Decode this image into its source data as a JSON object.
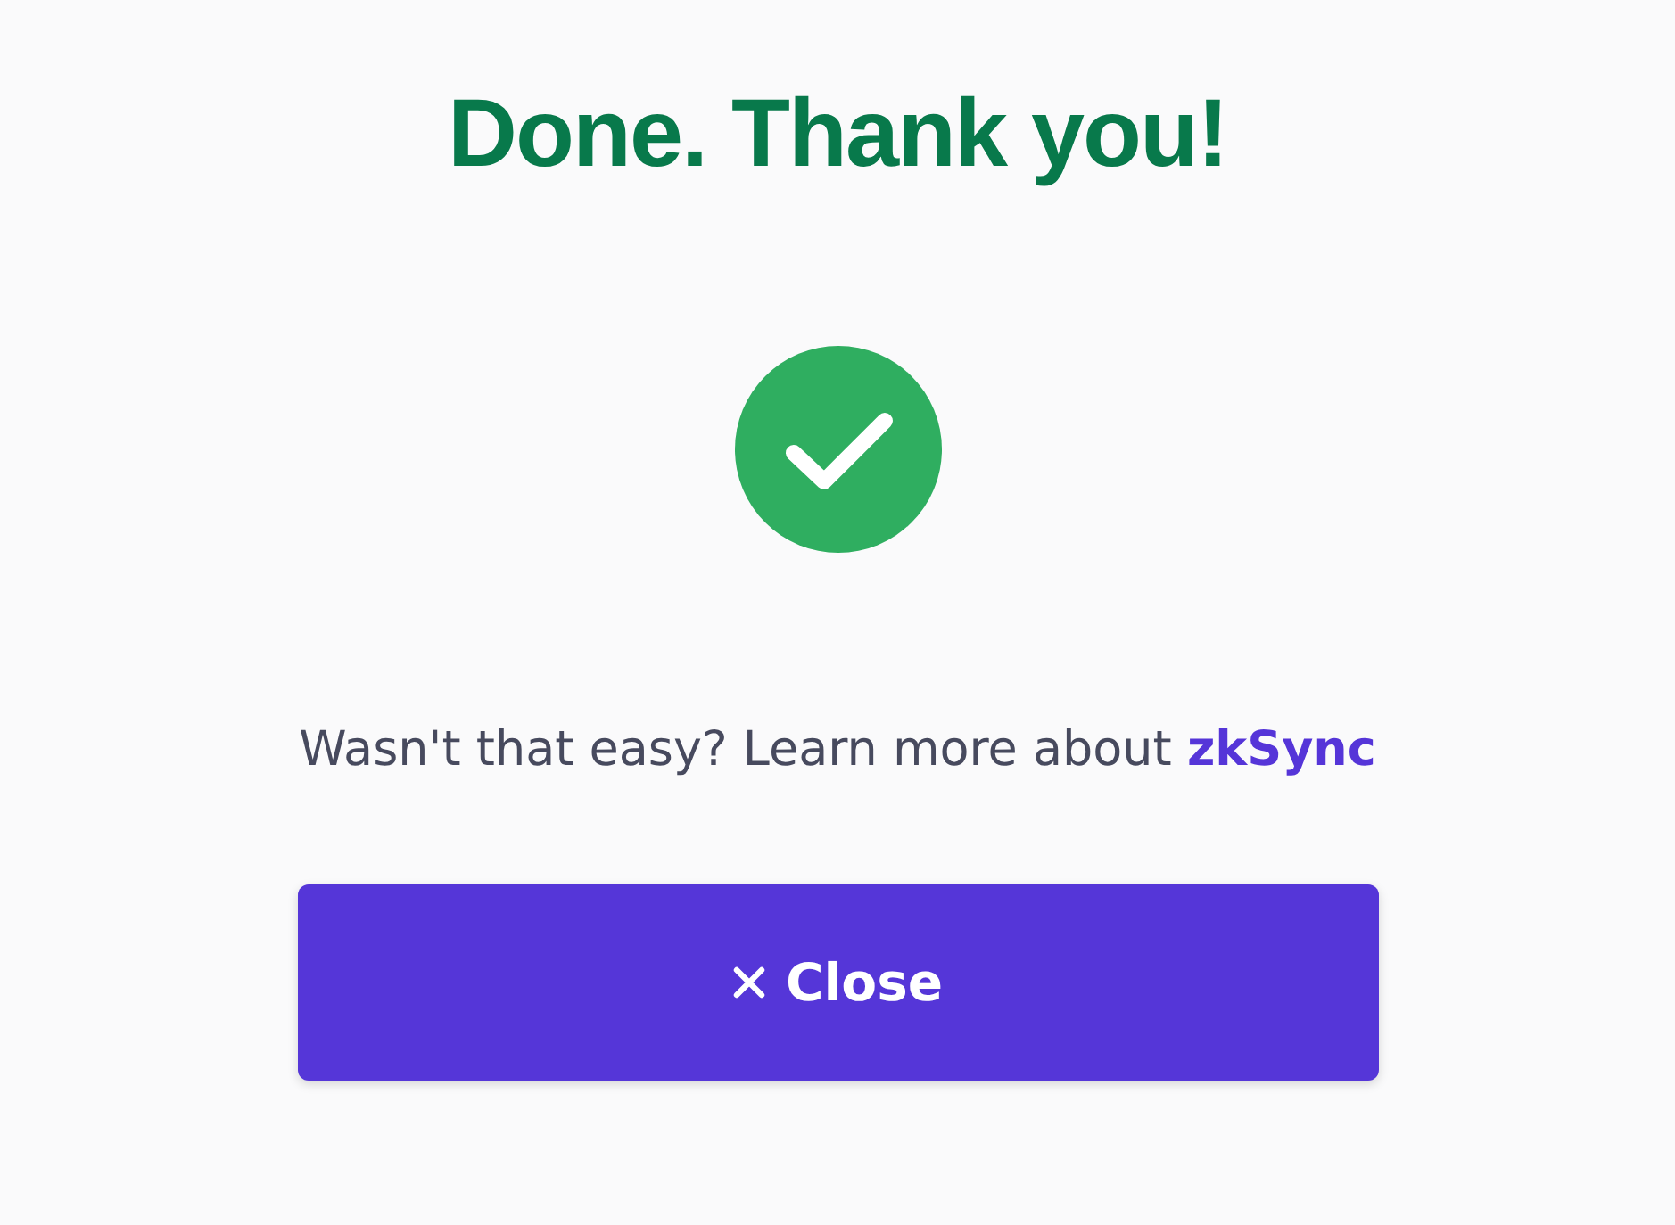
{
  "title": "Done. Thank you!",
  "status": {
    "kind": "success"
  },
  "message": {
    "text": "Wasn't that easy? Learn more about",
    "link": "zkSync"
  },
  "button": {
    "label": "Close"
  }
}
